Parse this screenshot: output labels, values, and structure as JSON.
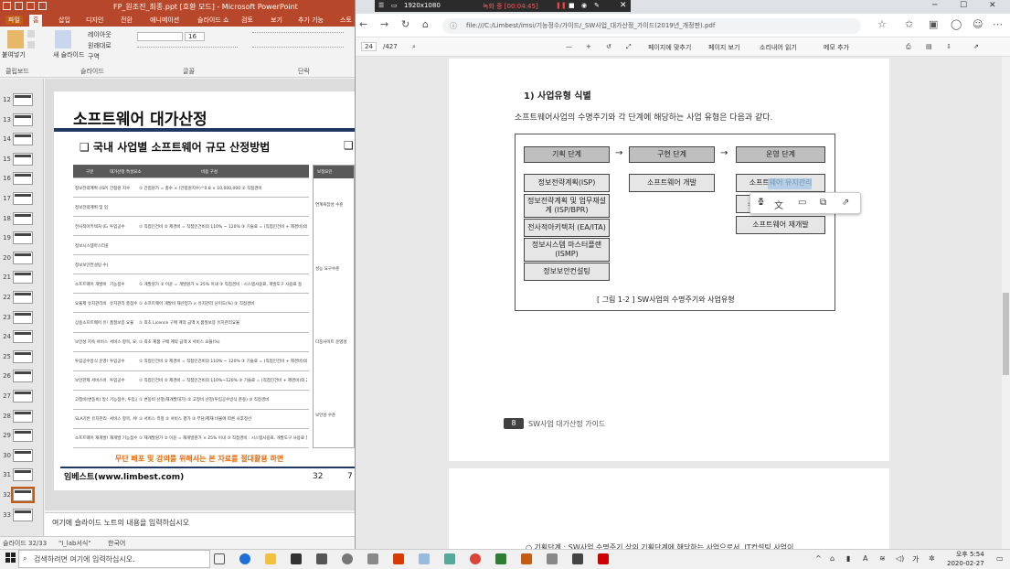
{
  "ppt": {
    "title": "FP_원조진_최종.ppt [호환 모드] - Microsoft PowerPoint",
    "tabs": [
      "파일",
      "홈",
      "삽입",
      "디자인",
      "전환",
      "애니메이션",
      "슬라이드 쇼",
      "검토",
      "보기",
      "추가 기능",
      "스토"
    ],
    "ribbon": {
      "paste": "붙여넣기",
      "new_slide": "새 슬라이드",
      "layout": "레이아웃",
      "reset": "원래대로",
      "section": "구역",
      "font_size": "16",
      "groups": [
        "클립보드",
        "슬라이드",
        "글꼴",
        "단락"
      ]
    },
    "thumb_numbers": [
      "12",
      "13",
      "14",
      "15",
      "16",
      "17",
      "18",
      "19",
      "20",
      "21",
      "22",
      "23",
      "24",
      "25",
      "26",
      "27",
      "28",
      "29",
      "30",
      "31",
      "32",
      "33"
    ],
    "slide": {
      "title": "소프트웨어 대가산정",
      "subtitle": "❑ 국내 사업별 소프트웨어 규모 산정방법",
      "subtitle_right": "❑",
      "table_header": [
        "구분",
        "대가산정 특성요소",
        "비용 구성"
      ],
      "rows": [
        [
          "정보전략계획 (ISP) 수립비",
          "간접원 지수",
          "① 간접원가 = 총수 × (간접원지수)^0.8 × 10,000,000  ② 직접경비"
        ],
        [
          "정보전략계획 및 업무재설계 (ISP/BPR) 수립비",
          "",
          ""
        ],
        [
          "전사적아키텍처 (EA/ITA) 수립비",
          "투입공수",
          "① 직접인건비 ② 제경비 = 직접인건비의 110% ~ 120% ③ 기술료 = (직접인건비 + 제경비)의 20% ~ 40% ④ 직접경비"
        ],
        [
          "정보시스템마스터플랜 (ISMP) 수립비",
          "",
          ""
        ],
        [
          "정보보안컨설팅 수립비",
          "",
          ""
        ],
        [
          "소프트웨어 개발비",
          "기능점수",
          "① 개발원가   ② 이윤 = 개발원가 × 25% 이내  ③ 직접경비 : 시스템사용료, 개발도구 사용료 등"
        ],
        [
          "요율제 유지관리비",
          "유지관리 총점수",
          "① 소프트웨어 개발비 재산정가 × 유지관리 난이도(%)  ② 직접경비"
        ],
        [
          "상용소프트웨어 유지관리비",
          "품질보증 요율",
          "① 최초 Licence 구매 계약 금액 X 품질보증 유지관리요율"
        ],
        [
          "보안성 지속 서비스비",
          "서비스 항목, 요율",
          "① 최초 제품 구매 계약 금액 X 서비스 요율(%)"
        ],
        [
          "투입공수방식 운영비",
          "투입공수",
          "① 직접인건비 ② 제경비 = 직접인건비의 110% ~ 120%  ③ 기술료 = (직접인건비 + 제경비)의 20% ~ 40%  ④ 직접경비"
        ],
        [
          "보안관제 서비스비",
          "투입공수",
          "① 직접인건비 ② 제경비 = 직접인건비의 110%~120%  ③ 기술료 = (직접인건비 + 제경비)의 20%~40%  ④ 직접경비"
        ],
        [
          "고정비(변동비) 방식의 유지관리 및 운영비",
          "기능점수, 투입공수",
          "① 변동비 산정(재개발대가)  ② 고정비 산정(투입공수방식 준용)  ③ 직접경비"
        ],
        [
          "SLA기반 유지관리 및 운영비 정산법",
          "서비스 항목, 서비스 제거 비용",
          "① 서비스 측정  ② 서비스 평가  ③ 부담/제재 비율에 따른 사후정산"
        ],
        [
          "소프트웨어 재개발비",
          "재개발 기능점수",
          "① 재개발원가   ② 이윤 = 재개발원가 × 25% 이내  ③ 직접경비 : 시스템사용료, 개발도구 사용료 등"
        ]
      ],
      "right_table_labels": [
        "보정요인",
        "연계복잡성 수준",
        "성능 요구수준",
        "다중사이트 운영성",
        "보안성 수준"
      ],
      "warning": "무단 배포 및 강의를 위해서는 본 자료를 절대활용 하면",
      "brand": "임베스트(www.limbest.com)",
      "page": "32",
      "page2": "7"
    },
    "notes_placeholder": "여기에 슬라이드 노트의 내용을 입력하십시오",
    "status": [
      "슬라이드 32/33",
      "\"I_lab서식\"",
      "한국어"
    ]
  },
  "recorder": {
    "resolution": "1920x1080",
    "status": "녹화 중 [00:04:45]"
  },
  "browser": {
    "url": "file:///C:/Limbest/imsi/기능정수/가이드/_SW사업_대가산정_가이드(2019년_개정판).pdf",
    "pdf_toolbar": {
      "page_current": "24",
      "page_total": "/427",
      "fit_page": "페이지에 맞추기",
      "page_view": "페이지 보기",
      "read_aloud": "소리내어 읽기",
      "add_note": "메모 추가"
    }
  },
  "pdf": {
    "section_heading": "1) 사업유형 식별",
    "intro": "소프트웨어사업의 수명주기와 각 단계에 해당하는 사업 유형은 다음과 같다.",
    "diagram": {
      "stages": [
        "기획 단계",
        "구현 단계",
        "운영 단계"
      ],
      "arrow": "→",
      "planning": [
        "정보전략계획(ISP)",
        "정보전략계획 및 업무재설계 (ISP/BPR)",
        "전사적아키텍처 (EA/ITA)",
        "정보시스템 마스터플랜 (ISMP)",
        "정보보안컨설팅"
      ],
      "implementation": [
        "소프트웨어 개발"
      ],
      "operation": [
        "소프트웨어 유지관리",
        "소프트웨어 운영",
        "소프트웨어 재개발"
      ],
      "operation_visible": [
        "소프트웨어 유지관리",
        "소프",
        "소프트웨어 재개발"
      ]
    },
    "caption": "[ 그림 1-2 ]  SW사업의 수명주기와 사업유형",
    "footer_num": "8",
    "footer_text": "SW사업 대가산정 가이드",
    "next_page_line": "○  기획단계 : SW사업 수명주기 상의 기획단계에 해당하는 사업으로서, IT컨설팅 사업이"
  },
  "taskbar": {
    "search_placeholder": "검색하려면 여기에 입력하십시오.",
    "time": "오후 5:54",
    "date": "2020-02-27"
  }
}
